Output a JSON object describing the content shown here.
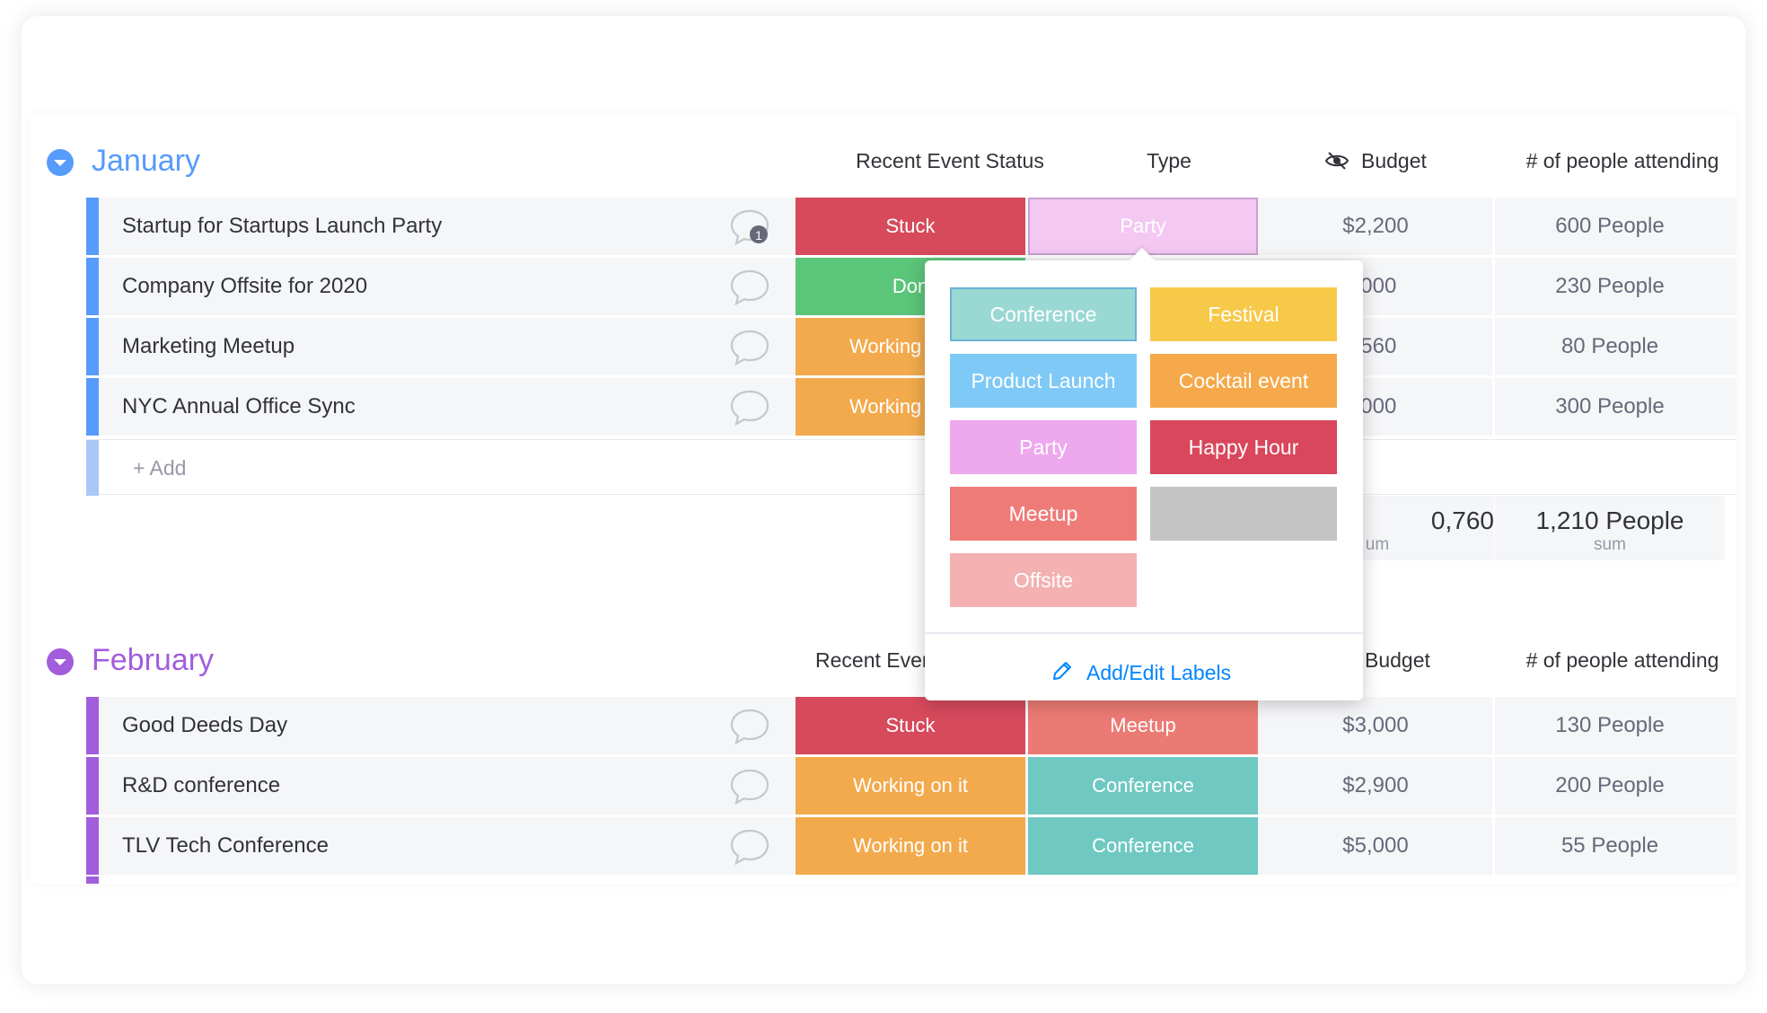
{
  "columns": {
    "status": "Recent Event Status",
    "type": "Type",
    "budget": "Budget",
    "people": "# of people attending",
    "status_truncated": "Recent Even"
  },
  "colors": {
    "january": "#579bfc",
    "february": "#a25ddc",
    "stuck": "#e2445c",
    "done": "#00c875",
    "working": "#fdab3d",
    "conference": "#66ccc2",
    "meetup": "#f27b73",
    "party_selected": "#f3c8f2"
  },
  "groups": [
    {
      "title": "January",
      "rows": [
        {
          "name": "Startup for Startups Launch Party",
          "status": "Stuck",
          "type": "Party",
          "budget": "$2,200",
          "people": "600 People",
          "updates": "1"
        },
        {
          "name": "Company Offsite for 2020",
          "status": "Don",
          "type": "",
          "budget": ",000",
          "people": "230 People"
        },
        {
          "name": "Marketing Meetup",
          "status": "Working",
          "type": "",
          "budget": ",560",
          "people": "80 People"
        },
        {
          "name": "NYC Annual Office Sync",
          "status": "Working",
          "type": "",
          "budget": ",000",
          "people": "300 People"
        }
      ],
      "add_label": "+ Add",
      "sum_budget": "0,760",
      "sum_budget_label": "um",
      "sum_people": "1,210 People",
      "sum_people_label": "sum"
    },
    {
      "title": "February",
      "rows": [
        {
          "name": "Good Deeds Day",
          "status": "Stuck",
          "type": "Meetup",
          "budget": "$3,000",
          "people": "130 People"
        },
        {
          "name": "R&D conference",
          "status": "Working on it",
          "type": "Conference",
          "budget": "$2,900",
          "people": "200 People"
        },
        {
          "name": "TLV Tech Conference",
          "status": "Working on it",
          "type": "Conference",
          "budget": "$5,000",
          "people": "55 People"
        }
      ]
    }
  ],
  "dropdown": {
    "labels": [
      {
        "text": "Conference",
        "color": "#9ad9d3"
      },
      {
        "text": "Festival",
        "color": "#f7c948"
      },
      {
        "text": "Product Launch",
        "color": "#7ec9f5"
      },
      {
        "text": "Cocktail event",
        "color": "#f5a94a"
      },
      {
        "text": "Party",
        "color": "#eda8ee"
      },
      {
        "text": "Happy Hour",
        "color": "#d9475c"
      },
      {
        "text": "Meetup",
        "color": "#ef7b79"
      },
      {
        "text": "",
        "color": "#c4c4c4"
      },
      {
        "text": "Offsite",
        "color": "#f4b1b1"
      }
    ],
    "edit_label": "Add/Edit Labels"
  }
}
